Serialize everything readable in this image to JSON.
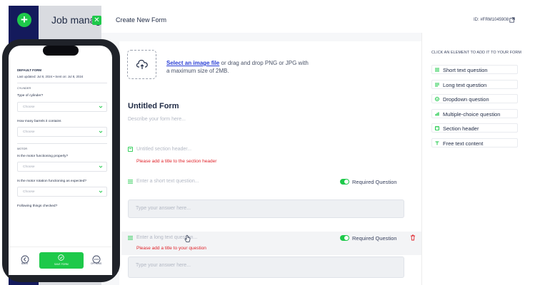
{
  "background": {
    "sidebar_title": "Job manag"
  },
  "header": {
    "title": "Create New Form",
    "form_id": "ID: #FRM1045908"
  },
  "upload": {
    "link_text": "Select an image file",
    "text_after": " or drag and drop PNG or JPG with a maximum size of 2MB."
  },
  "form": {
    "title": "Untitled Form",
    "description_placeholder": "Describe your form here...",
    "section_placeholder": "Untitled section header...",
    "section_error": "Please add a title to the section header",
    "short_question_placeholder": "Enter a short text question...",
    "short_required_label": "Required Question",
    "short_answer_placeholder": "Type your answer here...",
    "long_question_placeholder": "Enter a long text question...",
    "long_required_label": "Required Question",
    "long_error": "Please add a title to your question",
    "long_answer_placeholder": "Type your answer here..."
  },
  "sidebar": {
    "heading": "CLICK AN ELEMENT TO ADD IT TO YOUR FORM",
    "items": [
      {
        "label": "Short text question",
        "icon": "short-text-icon"
      },
      {
        "label": "Long text question",
        "icon": "long-text-icon"
      },
      {
        "label": "Dropdown question",
        "icon": "dropdown-icon"
      },
      {
        "label": "Multiple-choice question",
        "icon": "multiple-choice-icon"
      },
      {
        "label": "Section header",
        "icon": "section-header-icon"
      },
      {
        "label": "Free text content",
        "icon": "free-text-icon"
      }
    ]
  },
  "phone": {
    "form_label": "DEFAULT FORM",
    "updated": "Last updated: Jul 8, 2024 • Sent on: Jul 8, 2024",
    "sections": [
      {
        "name": "CYLINDER",
        "questions": [
          {
            "label": "Type of cylinder?",
            "value": "Choose"
          },
          {
            "label": "How many barrels it contains",
            "value": "Choose"
          }
        ]
      },
      {
        "name": "MOTOR",
        "questions": [
          {
            "label": "Is the motor functioning properly?",
            "value": "Choose"
          },
          {
            "label": "Is the motor rotation functioning as expected?",
            "value": "Choose"
          },
          {
            "label": "Following things checked?",
            "value": ""
          }
        ]
      }
    ],
    "bottom": {
      "back": "BACK",
      "save": "SAVE FORM",
      "options": "OPTIONS"
    }
  },
  "colors": {
    "accent": "#1ec94a",
    "navy": "#141a5c",
    "error": "#e0242b",
    "link": "#2a3fd6"
  }
}
